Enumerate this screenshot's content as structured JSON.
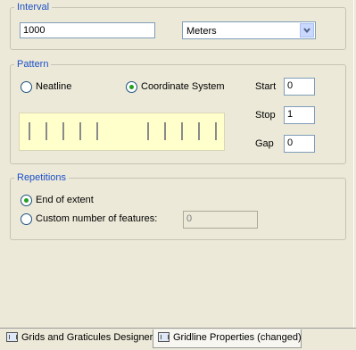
{
  "interval": {
    "legend": "Interval",
    "value": "1000",
    "units": "Meters"
  },
  "pattern": {
    "legend": "Pattern",
    "neatline_label": "Neatline",
    "coordinate_system_label": "Coordinate System",
    "selected": "Coordinate System",
    "start_label": "Start",
    "start_value": "0",
    "stop_label": "Stop",
    "stop_value": "1",
    "gap_label": "Gap",
    "gap_value": "0"
  },
  "repetitions": {
    "legend": "Repetitions",
    "end_of_extent_label": "End of extent",
    "custom_label": "Custom number of features:",
    "custom_value": "0",
    "selected": "End of extent"
  },
  "tabs": [
    {
      "label": "Grids and Graticules Designer",
      "active": false
    },
    {
      "label": "Gridline Properties (changed)",
      "active": true
    }
  ],
  "colors": {
    "legend_text": "#1c4fc7",
    "preview_background": "#ffffcc",
    "window_background": "#ece9d8"
  }
}
